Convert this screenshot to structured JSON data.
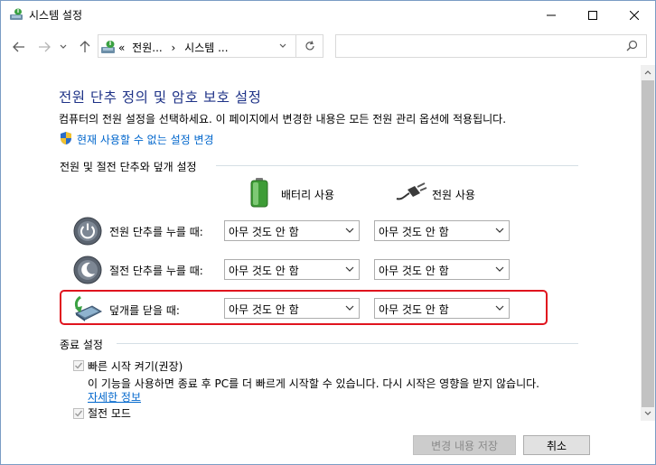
{
  "window": {
    "title": "시스템 설정",
    "title_icon": "power-options-icon"
  },
  "address": {
    "prefix": "«",
    "crumb1": "전원...",
    "sep": "›",
    "crumb2": "시스템 ...",
    "search_placeholder": ""
  },
  "main": {
    "heading": "전원 단추 정의 및 암호 보호 설정",
    "description": "컴퓨터의 전원 설정을 선택하세요. 이 페이지에서 변경한 내용은 모든 전원 관리 옵션에 적용됩니다.",
    "admin_link": "현재 사용할 수 없는 설정 변경",
    "section1_title": "전원 및 절전 단추와 덮개 설정",
    "col_battery": "배터리 사용",
    "col_plugged": "전원 사용",
    "rows": [
      {
        "label": "전원 단추를 누를 때:",
        "battery": "아무 것도 안 함",
        "plugged": "아무 것도 안 함"
      },
      {
        "label": "절전 단추를 누를 때:",
        "battery": "아무 것도 안 함",
        "plugged": "아무 것도 안 함"
      },
      {
        "label": "덮개를 닫을 때:",
        "battery": "아무 것도 안 함",
        "plugged": "아무 것도 안 함"
      }
    ],
    "section2_title": "종료 설정",
    "fast_startup": {
      "label": "빠른 시작 켜기(권장)",
      "checked": true,
      "desc": "이 기능을 사용하면 종료 후 PC를 더 빠르게 시작할 수 있습니다. 다시 시작은 영향을 받지 않습니다.",
      "more_link": "자세한 정보"
    },
    "sleep": {
      "label": "절전 모드",
      "checked": true
    }
  },
  "footer": {
    "save_label": "변경 내용 저장",
    "cancel_label": "취소"
  },
  "colors": {
    "heading": "#1e3287",
    "link": "#0066cc",
    "highlight_border": "#e0141e"
  }
}
